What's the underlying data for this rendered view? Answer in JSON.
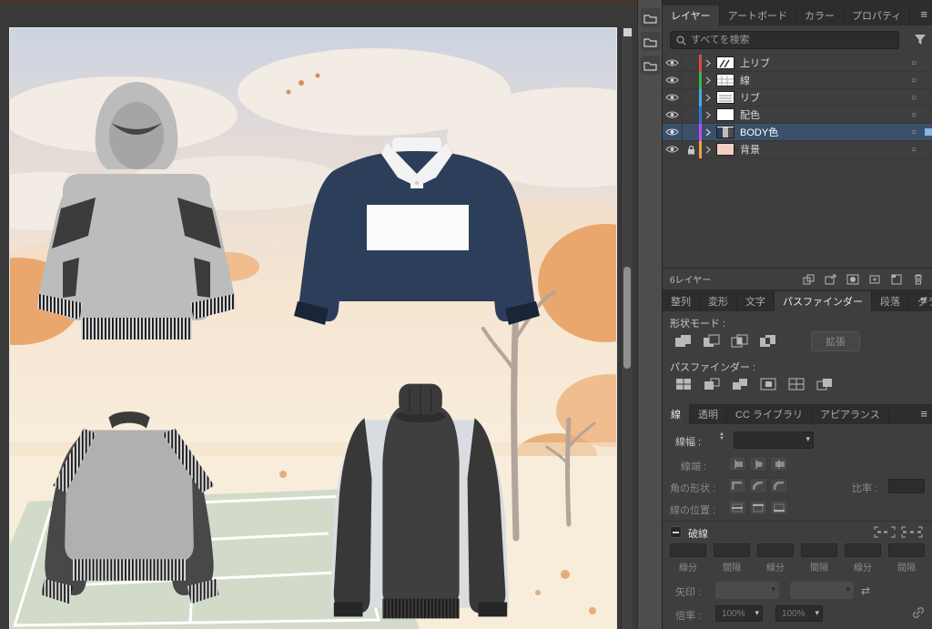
{
  "colors": {
    "panel_bg": "#3e3e3e",
    "panel_dark": "#2d2d2d",
    "field_bg": "#2c2c2c",
    "selected_row": "#3a506b",
    "canvas_frame": "#393939",
    "canvas_top": "#46352e",
    "hoodie_gray": "#bcbcbc",
    "rugby_navy": "#2d3e5b",
    "garment_dark": "#3f3f3f",
    "side_panel_light": "#d9dce0"
  },
  "layers_panel": {
    "tabs": [
      {
        "label": "レイヤー"
      },
      {
        "label": "アートボード"
      },
      {
        "label": "カラー"
      },
      {
        "label": "プロパティ"
      }
    ],
    "active_tab": "レイヤー",
    "search_placeholder": "すべてを検索",
    "rows": [
      {
        "name": "上リブ",
        "color": "#e0483e"
      },
      {
        "name": "線",
        "color": "#39b54a"
      },
      {
        "name": "リブ",
        "color": "#4aa8e8"
      },
      {
        "name": "配色",
        "color": "#2f6fde"
      },
      {
        "name": "BODY色",
        "color": "#c64af0",
        "selected": true,
        "selection_chip": "#8ab4e8"
      },
      {
        "name": "背景",
        "color": "#f0a23c",
        "locked": true
      }
    ],
    "status": "6レイヤー",
    "bottom_icons": [
      "collect-for-export",
      "locate-object",
      "make-clipping-mask",
      "new-sublayer",
      "new-layer",
      "delete"
    ]
  },
  "pathfinder_panel": {
    "tabs": [
      {
        "label": "整列"
      },
      {
        "label": "変形"
      },
      {
        "label": "文字"
      },
      {
        "label": "パスファインダー"
      },
      {
        "label": "段落"
      },
      {
        "label": "グラデーシ"
      }
    ],
    "active_tab": "パスファインダー",
    "shape_mode_label": "形状モード :",
    "expand_button": "拡張",
    "pathfinder_label": "パスファインダー :"
  },
  "stroke_panel": {
    "tabs": [
      {
        "label": "線"
      },
      {
        "label": "透明"
      },
      {
        "label": "CC ライブラリ"
      },
      {
        "label": "アピアランス"
      }
    ],
    "active_tab": "線",
    "weight_label": "線幅 :",
    "cap_label": "線端 :",
    "corner_label": "角の形状 :",
    "ratio_label": "比率 :",
    "align_label": "線の位置 :",
    "dashed_label": "破線",
    "dash_labels": [
      "線分",
      "間隔",
      "線分",
      "間隔",
      "線分",
      "間隔"
    ],
    "arrow_label": "矢印 :",
    "scale_label": "倍率 :",
    "scale_values": [
      "100%",
      "100%"
    ]
  }
}
